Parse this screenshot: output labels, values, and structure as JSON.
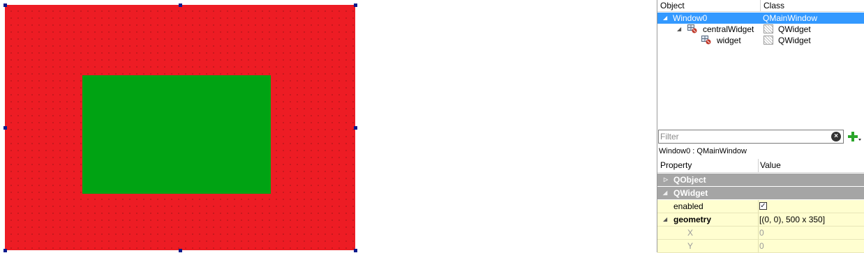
{
  "object_inspector": {
    "headers": {
      "object": "Object",
      "class": "Class"
    },
    "rows": [
      {
        "name": "Window0",
        "class": "QMainWindow",
        "selected": true
      },
      {
        "name": "centralWidget",
        "class": "QWidget",
        "selected": false
      },
      {
        "name": "widget",
        "class": "QWidget",
        "selected": false
      }
    ]
  },
  "property_editor": {
    "filter_placeholder": "Filter",
    "object_class": "Window0 : QMainWindow",
    "headers": {
      "property": "Property",
      "value": "Value"
    },
    "groups": [
      {
        "label": "QObject",
        "expanded": false
      },
      {
        "label": "QWidget",
        "expanded": true
      }
    ],
    "properties": [
      {
        "name": "enabled",
        "value_checked": true
      },
      {
        "name": "geometry",
        "value": "[(0, 0), 500 x 350]"
      },
      {
        "name": "X",
        "value": "0"
      },
      {
        "name": "Y",
        "value": "0"
      }
    ]
  },
  "colors": {
    "canvas_background": "#ed1c24",
    "inner_widget": "#00a313",
    "selection": "#3399ff",
    "selection_handles": "#0a1a8c",
    "group_header": "#a5a5a5",
    "property_row": "#fffed0"
  }
}
